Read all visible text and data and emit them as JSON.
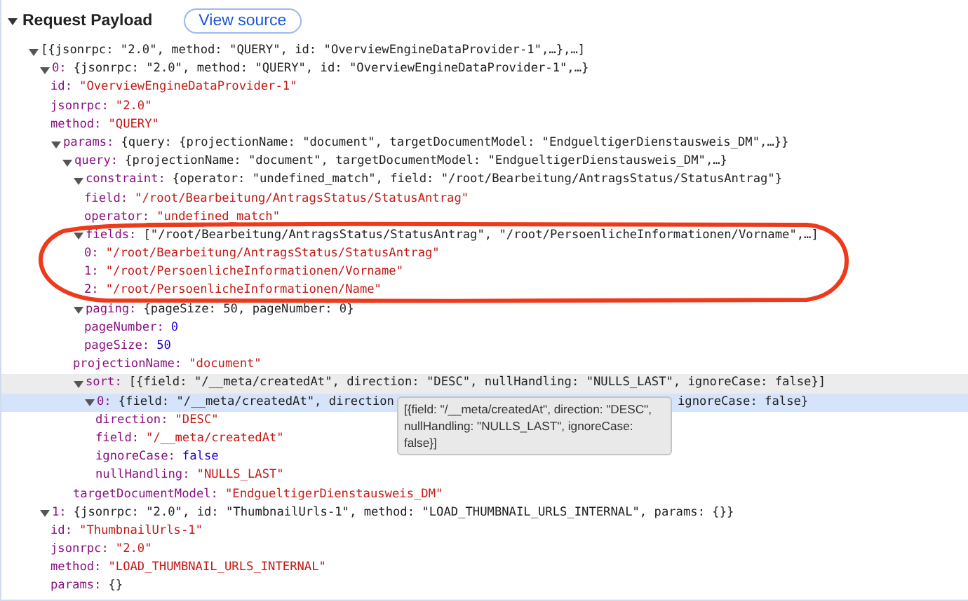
{
  "section": {
    "title": "Request Payload",
    "expanded": true
  },
  "view_source": "View source",
  "tree": [
    {
      "preview": "[{jsonrpc: \"2.0\", method: \"QUERY\", id: \"OverviewEngineDataProvider-1\",…},…]",
      "expanded": true,
      "selected": false,
      "hovered": false,
      "children": [
        {
          "key": "0:",
          "preview": "{jsonrpc: \"2.0\", method: \"QUERY\", id: \"OverviewEngineDataProvider-1\",…}",
          "expanded": true,
          "selected": false,
          "hovered": false,
          "children": [
            {
              "key": "id:",
              "value": "\"OverviewEngineDataProvider-1\"",
              "kind": "string",
              "selected": false,
              "hovered": false
            },
            {
              "key": "jsonrpc:",
              "value": "\"2.0\"",
              "kind": "string",
              "selected": false,
              "hovered": false
            },
            {
              "key": "method:",
              "value": "\"QUERY\"",
              "kind": "string",
              "selected": false,
              "hovered": false
            },
            {
              "key": "params:",
              "preview": "{query: {projectionName: \"document\", targetDocumentModel: \"EndgueltigerDienstausweis_DM\",…}}",
              "expanded": true,
              "selected": false,
              "hovered": false,
              "children": [
                {
                  "key": "query:",
                  "preview": "{projectionName: \"document\", targetDocumentModel: \"EndgueltigerDienstausweis_DM\",…}",
                  "expanded": true,
                  "selected": false,
                  "hovered": false,
                  "children": [
                    {
                      "key": "constraint:",
                      "preview": "{operator: \"undefined_match\", field: \"/root/Bearbeitung/AntragsStatus/StatusAntrag\"}",
                      "expanded": true,
                      "selected": false,
                      "hovered": false,
                      "children": [
                        {
                          "key": "field:",
                          "value": "\"/root/Bearbeitung/AntragsStatus/StatusAntrag\"",
                          "kind": "string",
                          "selected": false,
                          "hovered": false
                        },
                        {
                          "key": "operator:",
                          "value": "\"undefined_match\"",
                          "kind": "string",
                          "selected": false,
                          "hovered": false
                        }
                      ]
                    },
                    {
                      "key": "fields:",
                      "preview": "[\"/root/Bearbeitung/AntragsStatus/StatusAntrag\", \"/root/PersoenlicheInformationen/Vorname\",…]",
                      "expanded": true,
                      "selected": false,
                      "hovered": false,
                      "children": [
                        {
                          "key": "0:",
                          "value": "\"/root/Bearbeitung/AntragsStatus/StatusAntrag\"",
                          "kind": "string",
                          "selected": false,
                          "hovered": false
                        },
                        {
                          "key": "1:",
                          "value": "\"/root/PersoenlicheInformationen/Vorname\"",
                          "kind": "string",
                          "selected": false,
                          "hovered": false
                        },
                        {
                          "key": "2:",
                          "value": "\"/root/PersoenlicheInformationen/Name\"",
                          "kind": "string",
                          "selected": false,
                          "hovered": false
                        }
                      ]
                    },
                    {
                      "key": "paging:",
                      "preview": "{pageSize: 50, pageNumber: 0}",
                      "expanded": true,
                      "selected": false,
                      "hovered": false,
                      "children": [
                        {
                          "key": "pageNumber:",
                          "value": "0",
                          "kind": "number",
                          "selected": false,
                          "hovered": false
                        },
                        {
                          "key": "pageSize:",
                          "value": "50",
                          "kind": "number",
                          "selected": false,
                          "hovered": false
                        }
                      ]
                    },
                    {
                      "key": "projectionName:",
                      "value": "\"document\"",
                      "kind": "string",
                      "selected": false,
                      "hovered": false
                    },
                    {
                      "key": "sort:",
                      "preview": "[{field: \"/__meta/createdAt\", direction: \"DESC\", nullHandling: \"NULLS_LAST\", ignoreCase: false}]",
                      "expanded": true,
                      "selected": false,
                      "hovered": true,
                      "children": [
                        {
                          "key": "0:",
                          "preview": "{field: \"/__meta/createdAt\", direction",
                          "preview_end": "ignoreCase: false}",
                          "tooltip": [
                            "[{field: \"/__meta/createdAt\", direction: \"DESC\",",
                            "nullHandling: \"NULLS_LAST\", ignoreCase:",
                            "false}]"
                          ],
                          "expanded": true,
                          "selected": true,
                          "hovered": false,
                          "children": [
                            {
                              "key": "direction:",
                              "value": "\"DESC\"",
                              "kind": "string",
                              "selected": false,
                              "hovered": false
                            },
                            {
                              "key": "field:",
                              "value": "\"/__meta/createdAt\"",
                              "kind": "string",
                              "selected": false,
                              "hovered": false
                            },
                            {
                              "key": "ignoreCase:",
                              "value": "false",
                              "kind": "boolean",
                              "selected": false,
                              "hovered": false
                            },
                            {
                              "key": "nullHandling:",
                              "value": "\"NULLS_LAST\"",
                              "kind": "string",
                              "selected": false,
                              "hovered": false
                            }
                          ]
                        }
                      ]
                    },
                    {
                      "key": "targetDocumentModel:",
                      "value": "\"EndgueltigerDienstausweis_DM\"",
                      "kind": "string",
                      "selected": false,
                      "hovered": false
                    }
                  ]
                }
              ]
            }
          ]
        },
        {
          "key": "1:",
          "preview": "{jsonrpc: \"2.0\", id: \"ThumbnailUrls-1\", method: \"LOAD_THUMBNAIL_URLS_INTERNAL\", params: {}}",
          "expanded": true,
          "selected": false,
          "hovered": false,
          "children": [
            {
              "key": "id:",
              "value": "\"ThumbnailUrls-1\"",
              "kind": "string",
              "selected": false,
              "hovered": false
            },
            {
              "key": "jsonrpc:",
              "value": "\"2.0\"",
              "kind": "string",
              "selected": false,
              "hovered": false
            },
            {
              "key": "method:",
              "value": "\"LOAD_THUMBNAIL_URLS_INTERNAL\"",
              "kind": "string",
              "selected": false,
              "hovered": false
            },
            {
              "key": "params:",
              "value": "{}",
              "kind": "object",
              "selected": false,
              "hovered": false
            }
          ]
        }
      ]
    }
  ]
}
